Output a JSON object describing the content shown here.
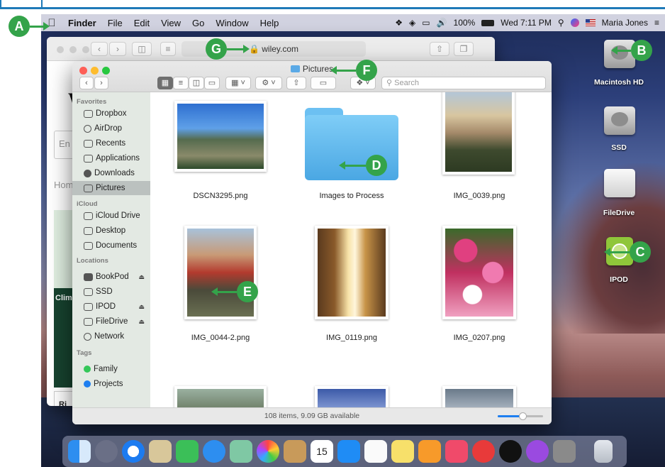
{
  "menubar": {
    "apple": "",
    "items": [
      "Finder",
      "File",
      "Edit",
      "View",
      "Go",
      "Window",
      "Help"
    ],
    "battery": "100%",
    "datetime": "Wed 7:11 PM",
    "user": "Maria Jones"
  },
  "safari": {
    "url": "wiley.com",
    "logo": "W",
    "search_prefix": "En",
    "nav_text": "Hom",
    "promo_text": "Clim",
    "bottom_text": "Ri"
  },
  "finder": {
    "title": "Pictures",
    "search_placeholder": "Search",
    "status": "108 items, 9.09 GB available",
    "sidebar": {
      "favorites_header": "Favorites",
      "favorites": [
        "Dropbox",
        "AirDrop",
        "Recents",
        "Applications",
        "Downloads",
        "Pictures"
      ],
      "icloud_header": "iCloud",
      "icloud": [
        "iCloud Drive",
        "Desktop",
        "Documents"
      ],
      "locations_header": "Locations",
      "locations": [
        "BookPod",
        "SSD",
        "IPOD",
        "FileDrive",
        "Network"
      ],
      "tags_header": "Tags",
      "tags": [
        "Family",
        "Projects"
      ]
    },
    "files": [
      "DSCN3295.png",
      "Images to Process",
      "IMG_0039.png",
      "IMG_0044-2.png",
      "IMG_0119.png",
      "IMG_0207.png"
    ]
  },
  "desktop": {
    "icons": [
      "Macintosh HD",
      "SSD",
      "FileDrive",
      "IPOD"
    ]
  },
  "callouts": [
    "A",
    "B",
    "C",
    "D",
    "E",
    "F",
    "G"
  ],
  "colors": {
    "callout": "#34a34a",
    "border": "#1f7ab8"
  }
}
